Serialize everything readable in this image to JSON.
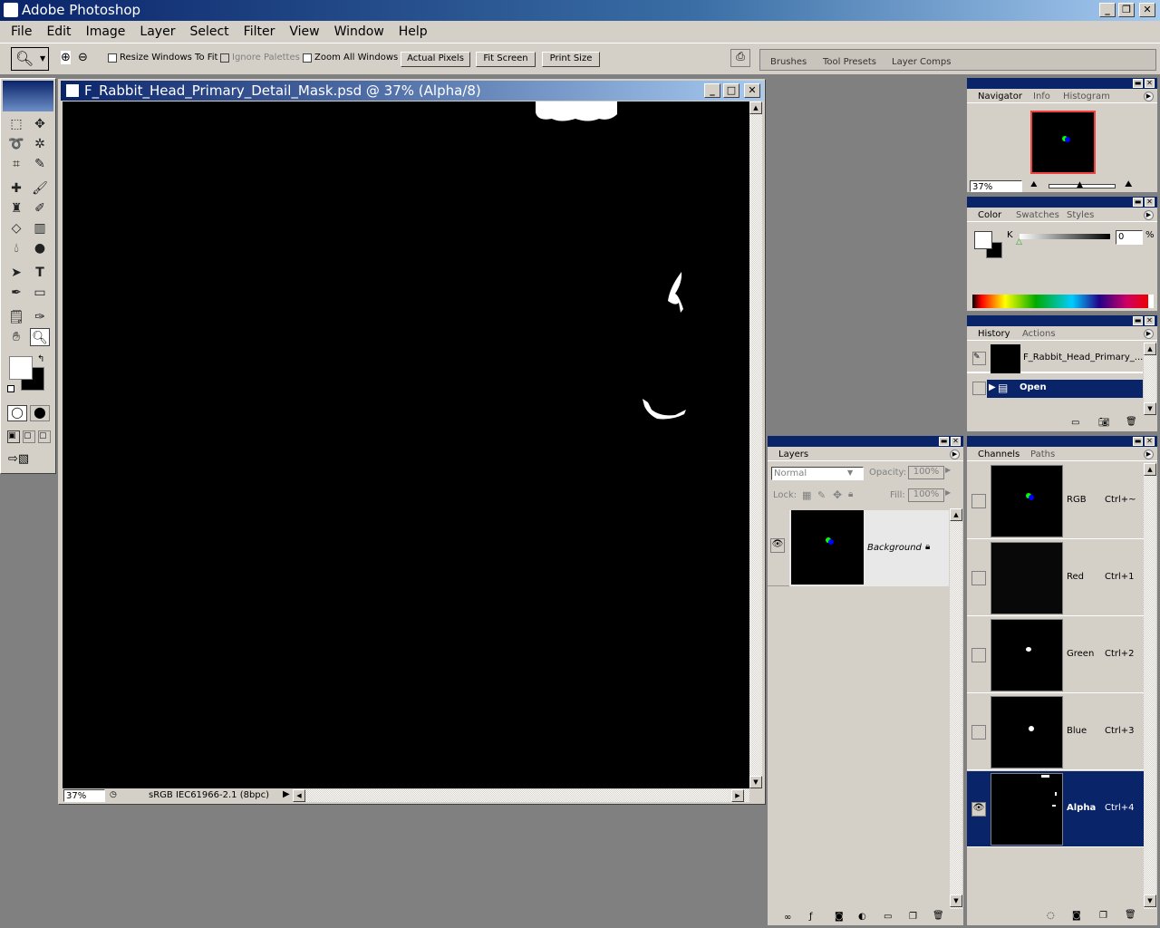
{
  "app": {
    "title": "Adobe Photoshop"
  },
  "menu": [
    "File",
    "Edit",
    "Image",
    "Layer",
    "Select",
    "Filter",
    "View",
    "Window",
    "Help"
  ],
  "options": {
    "resize_windows": "Resize Windows To Fit",
    "ignore_palettes": "Ignore Palettes",
    "zoom_all": "Zoom All Windows",
    "actual_pixels": "Actual Pixels",
    "fit_screen": "Fit Screen",
    "print_size": "Print Size"
  },
  "well_tabs": [
    "Brushes",
    "Tool Presets",
    "Layer Comps"
  ],
  "document": {
    "title": "F_Rabbit_Head_Primary_Detail_Mask.psd @ 37% (Alpha/8)",
    "zoom": "37%",
    "profile": "sRGB IEC61966-2.1 (8bpc)"
  },
  "navigator": {
    "tabs": [
      "Navigator",
      "Info",
      "Histogram"
    ],
    "zoom": "37%",
    "zoom_slider": 0.5
  },
  "color": {
    "tabs": [
      "Color",
      "Swatches",
      "Styles"
    ],
    "channel": "K",
    "value": "0",
    "unit": "%"
  },
  "history": {
    "tabs": [
      "History",
      "Actions"
    ],
    "snapshot": "F_Rabbit_Head_Primary_...",
    "step": "Open"
  },
  "layers": {
    "tab": "Layers",
    "blend": "Normal",
    "opacity_label": "Opacity:",
    "opacity": "100%",
    "lock_label": "Lock:",
    "fill_label": "Fill:",
    "fill": "100%",
    "layer_name": "Background"
  },
  "channels": {
    "tabs": [
      "Channels",
      "Paths"
    ],
    "rows": [
      {
        "name": "RGB",
        "shortcut": "Ctrl+~"
      },
      {
        "name": "Red",
        "shortcut": "Ctrl+1"
      },
      {
        "name": "Green",
        "shortcut": "Ctrl+2"
      },
      {
        "name": "Blue",
        "shortcut": "Ctrl+3"
      },
      {
        "name": "Alpha",
        "shortcut": "Ctrl+4"
      }
    ]
  },
  "colors": {
    "titlebar": "#0a246a",
    "selection": "#0a246a",
    "chrome": "#d4d0c8"
  }
}
